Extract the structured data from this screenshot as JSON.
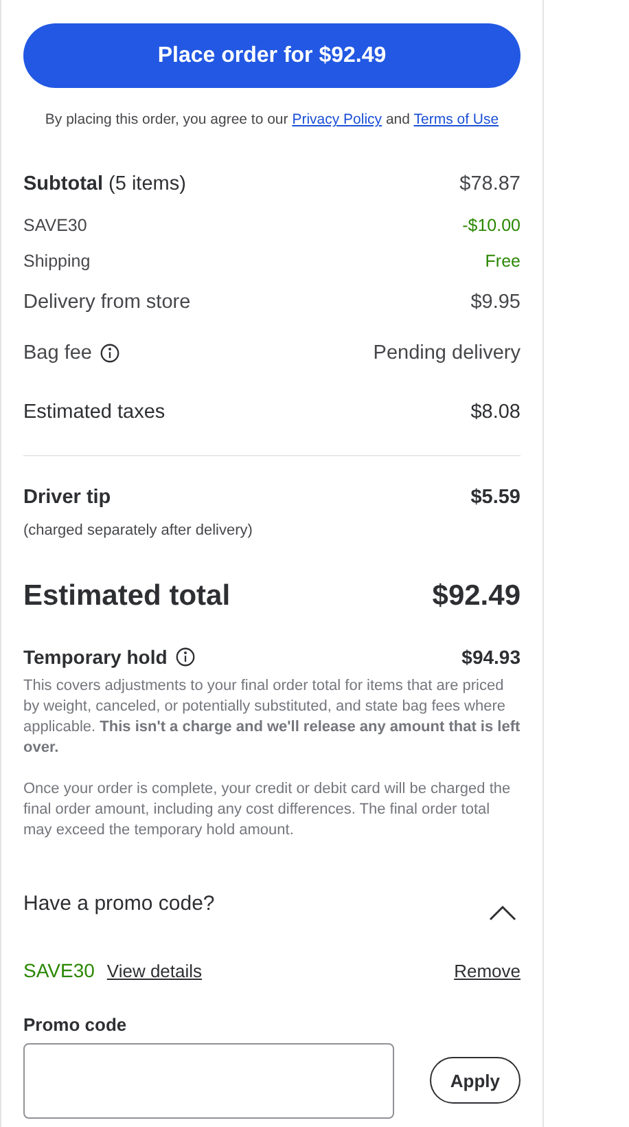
{
  "place_order_button": "Place order for $92.49",
  "agreement": {
    "text": "By placing this order, you agree to our",
    "privacy_link": "Privacy Policy",
    "joiner": "and",
    "terms_link": "Terms of Use"
  },
  "summary_rows": [
    {
      "label": "Subtotal",
      "note": "(5 items)",
      "value": "$78.87",
      "kind": "regular",
      "bold_label": true,
      "green_value": false,
      "dark": false
    },
    {
      "label": "SAVE30",
      "value": "-$10.00",
      "kind": "small",
      "bold_label": false,
      "green_value": true,
      "dark": false
    },
    {
      "label": "Shipping",
      "value": "Free",
      "kind": "small",
      "bold_label": false,
      "green_value": true,
      "dark": false
    },
    {
      "label": "Delivery from store",
      "value": "$9.95",
      "kind": "regular",
      "bold_label": false,
      "green_value": false,
      "dark": false
    },
    {
      "label": "Bag fee",
      "value": "Pending delivery",
      "kind": "regular",
      "bold_label": false,
      "green_value": false,
      "info": true,
      "dark": false
    },
    {
      "label": "Estimated taxes",
      "value": "$8.08",
      "kind": "regular",
      "bold_label": false,
      "green_value": false,
      "dark": true
    }
  ],
  "driver_tip": {
    "label": "Driver tip",
    "value": "$5.59",
    "note": "(charged separately after delivery)"
  },
  "estimated_total": {
    "label": "Estimated total",
    "value": "$92.49"
  },
  "temporary_hold": {
    "label": "Temporary hold",
    "value": "$94.93",
    "paragraphs": [
      "This covers adjustments to your final order total for items that are priced by weight, canceled, or potentially substituted, and state bag fees where applicable. **This isn't a charge and we'll release any amount that is left over.**",
      "Once your order is complete, your credit or debit card will be charged the final order amount, including any cost differences. The final order total may exceed the temporary hold amount."
    ]
  },
  "promo": {
    "title": "Have a promo code?",
    "expanded": true,
    "applied_code": "SAVE30",
    "view_details": "View details",
    "remove": "Remove",
    "field_label": "Promo code",
    "apply_button": "Apply"
  }
}
